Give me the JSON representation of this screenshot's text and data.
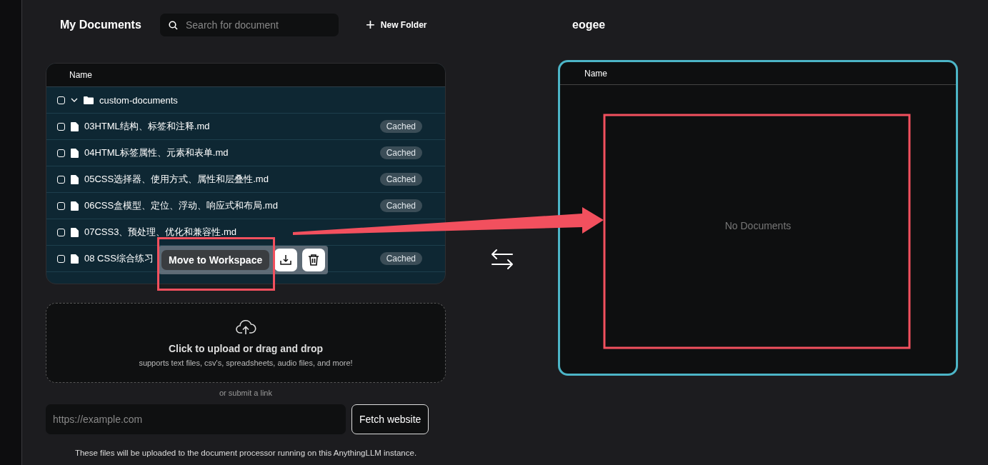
{
  "my_documents": {
    "title": "My Documents",
    "search": {
      "placeholder": "Search for document"
    },
    "new_folder": {
      "icon": "+",
      "label": "New Folder"
    },
    "table": {
      "columns": [
        "Name"
      ],
      "rows": [
        {
          "kind": "folder",
          "name": "custom-documents",
          "checked": false,
          "expanded": true
        },
        {
          "kind": "file",
          "name": "03HTML结构、标签和注释.md",
          "checked": false,
          "badge": "Cached"
        },
        {
          "kind": "file",
          "name": "04HTML标签属性、元素和表单.md",
          "checked": false,
          "badge": "Cached"
        },
        {
          "kind": "file",
          "name": "05CSS选择器、使用方式、属性和层叠性.md",
          "checked": false,
          "badge": "Cached"
        },
        {
          "kind": "file",
          "name": "06CSS盒模型、定位、浮动、响应式和布局.md",
          "checked": false,
          "badge": "Cached"
        },
        {
          "kind": "file",
          "name": "07CSS3、预处理、优化和兼容性.md",
          "checked": false
        },
        {
          "kind": "file",
          "name": "08 CSS综合练习",
          "checked": false,
          "badge": "Cached"
        }
      ]
    },
    "selection_bar": {
      "move_button": "Move to Workspace"
    },
    "upload": {
      "title": "Click to upload or drag and drop",
      "subtitle": "supports text files, csv's, spreadsheets, audio files, and more!"
    },
    "link_label": "or submit a link",
    "link_field": {
      "placeholder": "https://example.com"
    },
    "fetch_button": "Fetch website",
    "footer_note": "These files will be uploaded to the document processor running on this AnythingLLM instance."
  },
  "workspace": {
    "title": "eogee",
    "table": {
      "columns": [
        "Name"
      ]
    },
    "empty_text": "No Documents"
  }
}
